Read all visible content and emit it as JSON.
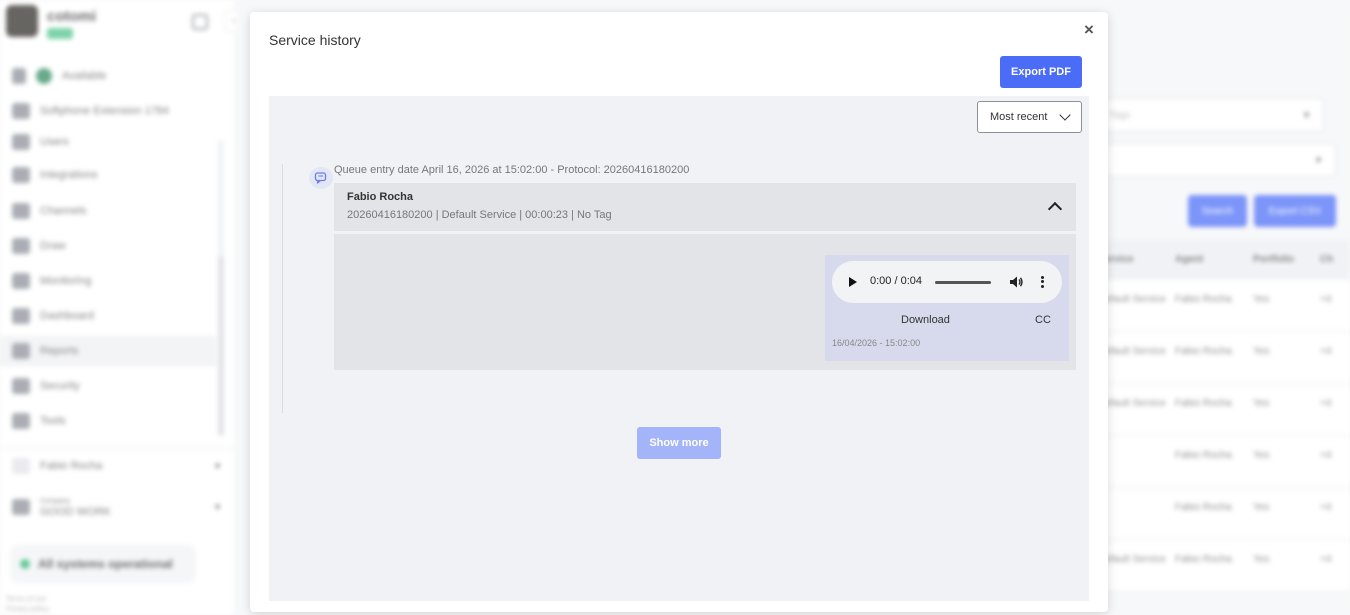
{
  "background": {
    "brand": "cotomi",
    "status_label": "Available",
    "softphone_label": "Softphone Extension 1784",
    "nav_items": [
      "Users",
      "Integrations",
      "Channels",
      "Draw",
      "Monitoring",
      "Dashboard",
      "Reports",
      "Security",
      "Tools"
    ],
    "user_name": "Fabio Rocha",
    "company_label": "Company",
    "company_name": "GOOD WORK",
    "systems_status": "All systems operational",
    "footer_lines": [
      "Terms of use",
      "Privacy policy"
    ],
    "filters": [
      "Tags",
      ""
    ],
    "buttons": [
      "Search",
      "Export CSV"
    ],
    "table_headers": [
      "Service",
      "Agent",
      "Portfolio",
      "Ch"
    ],
    "table_rows": [
      [
        "Default Service",
        "Fabio Rocha",
        "Yes",
        "+4"
      ],
      [
        "Default Service",
        "Fabio Rocha",
        "Yes",
        "+4"
      ],
      [
        "Default Service",
        "Fabio Rocha",
        "Yes",
        "+4"
      ],
      [
        "",
        "Fabio Rocha",
        "Yes",
        "+4"
      ],
      [
        "",
        "Fabio Rocha",
        "Yes",
        "+4"
      ],
      [
        "Default Service",
        "Fabio Rocha",
        "Yes",
        "+4"
      ]
    ]
  },
  "modal": {
    "title": "Service history",
    "close_symbol": "×",
    "export_pdf_label": "Export PDF",
    "sort": {
      "selected": "Most recent"
    },
    "entry": {
      "header": "Queue entry date April 16, 2026 at 15:02:00 - Protocol: 20260416180200",
      "agent_name": "Fabio Rocha",
      "meta": "20260416180200 | Default Service | 00:00:23 | No Tag"
    },
    "audio_message": {
      "time_display": "0:00 / 0:04",
      "download_label": "Download",
      "cc_label": "CC",
      "timestamp": "16/04/2026 - 15:02:00"
    },
    "show_more_label": "Show more"
  }
}
